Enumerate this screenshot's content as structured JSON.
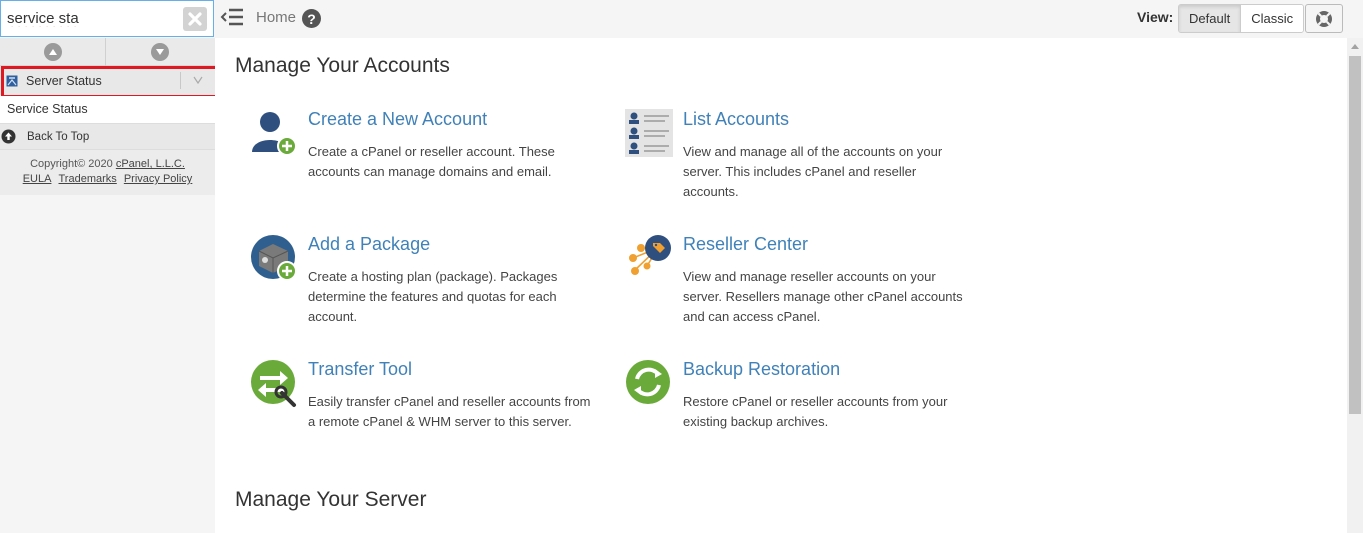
{
  "search": {
    "value": "service sta",
    "placeholder": ""
  },
  "sidebar": {
    "category_label": "Server Status",
    "result_item": "Service Status",
    "back_to_top": "Back To Top",
    "footer": {
      "copyright_prefix": "Copyright© 2020 ",
      "company": "cPanel, L.L.C.",
      "links": [
        "EULA",
        "Trademarks",
        "Privacy Policy"
      ]
    }
  },
  "topbar": {
    "home": "Home",
    "help_icon": "?",
    "view_label": "View:",
    "view_options": [
      "Default",
      "Classic"
    ],
    "view_selected": "Default"
  },
  "main": {
    "sections": [
      {
        "title": "Manage Your Accounts"
      },
      {
        "title": "Manage Your Server"
      }
    ],
    "tools": [
      {
        "title": "Create a New Account",
        "desc": "Create a cPanel or reseller account. These accounts can manage domains and email.",
        "icon": "add-user-icon"
      },
      {
        "title": "List Accounts",
        "desc": "View and manage all of the accounts on your server. This includes cPanel and reseller accounts.",
        "icon": "list-accounts-icon"
      },
      {
        "title": "Add a Package",
        "desc": "Create a hosting plan (package). Packages determine the features and quotas for each account.",
        "icon": "add-package-icon"
      },
      {
        "title": "Reseller Center",
        "desc": "View and manage reseller accounts on your server. Resellers manage other cPanel accounts and can access cPanel.",
        "icon": "reseller-center-icon"
      },
      {
        "title": "Transfer Tool",
        "desc": "Easily transfer cPanel and reseller accounts from a remote cPanel & WHM server to this server.",
        "icon": "transfer-tool-icon"
      },
      {
        "title": "Backup Restoration",
        "desc": "Restore cPanel or reseller accounts from your existing backup archives.",
        "icon": "backup-restoration-icon"
      }
    ]
  },
  "colors": {
    "link": "#3f81b8",
    "highlight": "#e01822",
    "green": "#6aaa3a",
    "navy": "#2f4f7f",
    "orange": "#f0a030"
  }
}
